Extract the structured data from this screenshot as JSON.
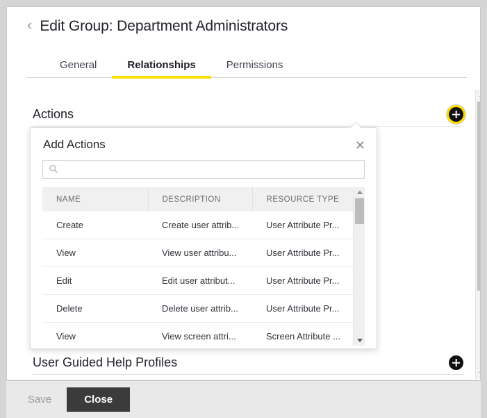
{
  "header": {
    "back_icon": "chevron-left-icon",
    "title": "Edit Group: Department Administrators"
  },
  "tabs": [
    {
      "label": "General",
      "active": false
    },
    {
      "label": "Relationships",
      "active": true
    },
    {
      "label": "Permissions",
      "active": false
    }
  ],
  "sections": {
    "actions": {
      "title": "Actions",
      "add_icon": "plus-icon"
    },
    "user_guided_help_profiles": {
      "title": "User Guided Help Profiles",
      "add_icon": "plus-icon"
    }
  },
  "popover": {
    "title": "Add Actions",
    "close_icon": "close-icon",
    "search": {
      "value": "",
      "placeholder": "",
      "icon": "search-icon"
    },
    "table": {
      "columns": [
        "NAME",
        "DESCRIPTION",
        "RESOURCE TYPE"
      ],
      "rows": [
        {
          "name": "Create",
          "description": "Create user attrib...",
          "resource_type": "User Attribute Pr..."
        },
        {
          "name": "View",
          "description": "View user attribu...",
          "resource_type": "User Attribute Pr..."
        },
        {
          "name": "Edit",
          "description": "Edit user attribut...",
          "resource_type": "User Attribute Pr..."
        },
        {
          "name": "Delete",
          "description": "Delete user attrib...",
          "resource_type": "User Attribute Pr..."
        },
        {
          "name": "View",
          "description": "View screen attri...",
          "resource_type": "Screen Attribute ..."
        }
      ]
    },
    "scrollbar": {
      "up_icon": "caret-up-icon",
      "down_icon": "caret-down-icon"
    }
  },
  "outer_scrollbar": {
    "up_icon": "caret-up-icon",
    "down_icon": "caret-down-icon"
  },
  "footer": {
    "save_label": "Save",
    "save_disabled": true,
    "close_label": "Close"
  },
  "colors": {
    "accent_yellow": "#FFDD00",
    "button_dark": "#3B3B3B",
    "footer_bg": "#E9E9E9",
    "text_primary": "#20232A"
  }
}
